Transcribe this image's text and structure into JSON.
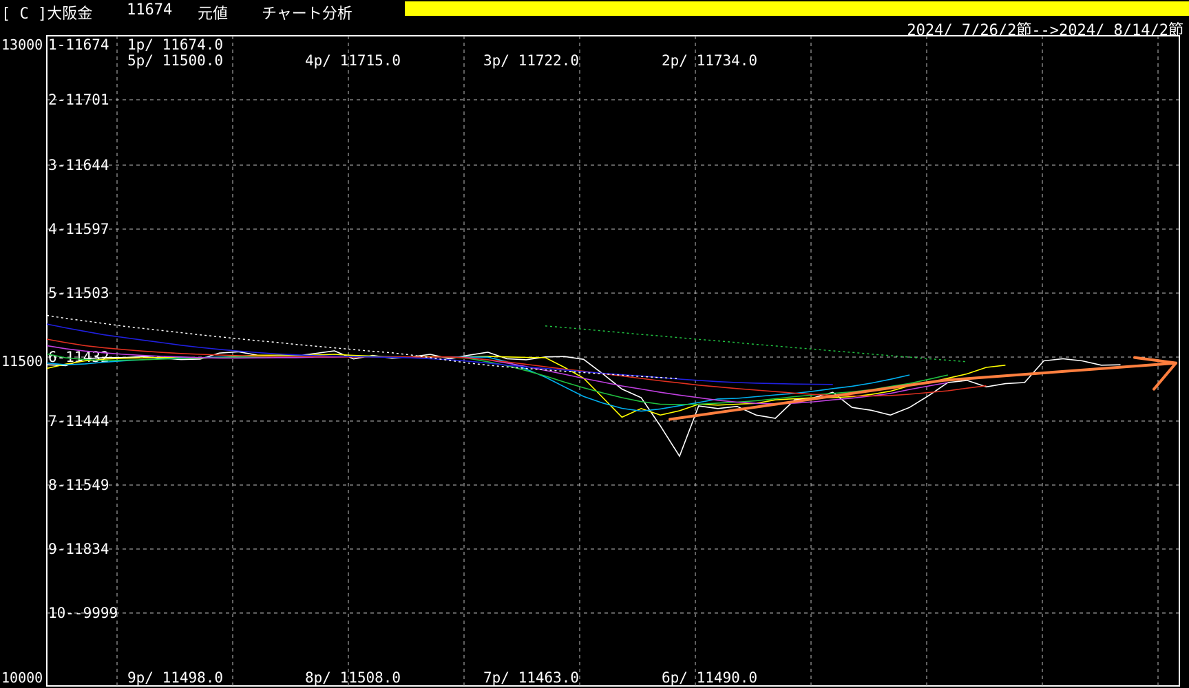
{
  "header": {
    "symbol": "[ C ]大阪金",
    "price": "11674",
    "mode": "元値",
    "tool": "チャート分析",
    "range": "2024/ 7/26/2節-->2024/ 8/14/2節",
    "highlight_color": "#ffff00"
  },
  "axis": {
    "top_label": "13000",
    "mid_label": "11500",
    "bottom_label": "10000"
  },
  "levels": [
    "1-11674",
    "2-11701",
    "3-11644",
    "4-11597",
    "5-11503",
    "6-11432",
    "7-11444",
    "8-11549",
    "9-11834",
    "10--9999"
  ],
  "pivots": [
    {
      "text": "1p/ 11674.0"
    },
    {
      "text": "5p/ 11500.0"
    },
    {
      "text": "4p/ 11715.0"
    },
    {
      "text": "3p/ 11722.0"
    },
    {
      "text": "2p/ 11734.0"
    },
    {
      "text": "9p/ 11498.0"
    },
    {
      "text": "8p/ 11508.0"
    },
    {
      "text": "7p/ 11463.0"
    },
    {
      "text": "6p/ 11490.0"
    }
  ],
  "chart_data": {
    "type": "line",
    "ylim": [
      10000,
      13000
    ],
    "grid": true,
    "n_periods": 60,
    "series": [
      {
        "color": "#ffffff",
        "dashed": false,
        "values": [
          11482,
          11478,
          11510,
          11515,
          11515,
          11520,
          11512,
          11506,
          11508,
          11536,
          11542,
          11526,
          11520,
          11523,
          11534,
          11546,
          11509,
          11525,
          11512,
          11518,
          11530,
          11510,
          11526,
          11540,
          11510,
          11505,
          11518,
          11520,
          11507,
          11440,
          11370,
          11330,
          11200,
          11060,
          11292,
          11280,
          11290,
          11250,
          11235,
          11320,
          11330,
          11355,
          11285,
          11272,
          11250,
          11285,
          11340,
          11400,
          11410,
          11380,
          11395,
          11400,
          11500,
          11510,
          11500,
          11480,
          11482
        ]
      },
      {
        "color": "#ffff00",
        "dashed": false,
        "values": [
          11465,
          11485,
          11500,
          11508,
          11512,
          11514,
          11516,
          11514,
          11512,
          11516,
          11522,
          11526,
          11526,
          11525,
          11527,
          11530,
          11525,
          11522,
          11518,
          11518,
          11520,
          11517,
          11518,
          11521,
          11518,
          11516,
          11515,
          11470,
          11420,
          11330,
          11240,
          11280,
          11250,
          11270,
          11300,
          11296,
          11300,
          11304,
          11320,
          11325,
          11330,
          11330,
          11335,
          11345,
          11360,
          11385,
          11400,
          11420,
          11440,
          11470,
          11480
        ]
      },
      {
        "color": "#00b0f0",
        "dashed": false,
        "values": [
          11490,
          11482,
          11486,
          11494,
          11500,
          11505,
          11510,
          11513,
          11515,
          11517,
          11518,
          11520,
          11522,
          11522,
          11522,
          11521,
          11520,
          11519,
          11519,
          11518,
          11518,
          11518,
          11517,
          11517,
          11496,
          11462,
          11425,
          11380,
          11336,
          11305,
          11281,
          11268,
          11278,
          11293,
          11308,
          11324,
          11327,
          11335,
          11343,
          11350,
          11360,
          11372,
          11383,
          11397,
          11415,
          11435
        ]
      },
      {
        "color": "#20c040",
        "dashed": false,
        "values": [
          11532,
          11514,
          11506,
          11502,
          11503,
          11505,
          11508,
          11511,
          11513,
          11515,
          11517,
          11518,
          11519,
          11520,
          11521,
          11520,
          11520,
          11519,
          11518,
          11518,
          11518,
          11518,
          11511,
          11496,
          11478,
          11455,
          11430,
          11402,
          11376,
          11352,
          11330,
          11312,
          11300,
          11298,
          11300,
          11305,
          11310,
          11316,
          11325,
          11335,
          11343,
          11350,
          11357,
          11367,
          11382,
          11396,
          11415,
          11435
        ]
      },
      {
        "color": "#c040e0",
        "dashed": false,
        "values": [
          11570,
          11556,
          11545,
          11537,
          11530,
          11525,
          11521,
          11518,
          11515,
          11513,
          11513,
          11514,
          11515,
          11515,
          11517,
          11517,
          11518,
          11518,
          11518,
          11518,
          11518,
          11518,
          11515,
          11505,
          11490,
          11474,
          11456,
          11438,
          11419,
          11402,
          11384,
          11370,
          11355,
          11342,
          11330,
          11318,
          11310,
          11304,
          11302,
          11305,
          11311,
          11320,
          11328,
          11338,
          11350,
          11368,
          11384,
          11400
        ]
      },
      {
        "color": "#e03020",
        "dashed": false,
        "values": [
          11600,
          11584,
          11570,
          11560,
          11552,
          11545,
          11539,
          11534,
          11530,
          11527,
          11524,
          11522,
          11521,
          11520,
          11519,
          11519,
          11518,
          11518,
          11518,
          11518,
          11518,
          11518,
          11513,
          11505,
          11495,
          11484,
          11473,
          11462,
          11452,
          11441,
          11430,
          11419,
          11408,
          11398,
          11388,
          11380,
          11372,
          11365,
          11358,
          11351,
          11345,
          11341,
          11338,
          11338,
          11340,
          11346,
          11354,
          11362,
          11374,
          11385
        ]
      },
      {
        "color": "#2020e0",
        "dashed": false,
        "values": [
          11670,
          11652,
          11636,
          11620,
          11608,
          11596,
          11584,
          11572,
          11562,
          11553,
          11545,
          11538,
          11532,
          11528,
          11524,
          11522,
          11520,
          11518,
          11516,
          11514,
          11510,
          11505,
          11498,
          11490,
          11480,
          11472,
          11465,
          11458,
          11450,
          11443,
          11436,
          11430,
          11423,
          11416,
          11410,
          11404,
          11400,
          11397,
          11395,
          11393,
          11392,
          11391
        ]
      },
      {
        "color": "#ffffff",
        "dashed": true,
        "values": [
          11710,
          11696,
          11684,
          11672,
          11660,
          11650,
          11640,
          11630,
          11620,
          11611,
          11602,
          11593,
          11585,
          11576,
          11568,
          11560,
          11552,
          11544,
          11537,
          11527,
          11515,
          11502,
          11490,
          11480,
          11472,
          11465,
          11458,
          11452,
          11446,
          11440,
          11434,
          11428,
          11423,
          11418
        ]
      },
      {
        "color": "#20c040",
        "dashed": true,
        "values": [
          11661,
          11654,
          11646,
          11638,
          11630,
          11622,
          11615,
          11607,
          11599,
          11592,
          11584,
          11576,
          11569,
          11561,
          11554,
          11546,
          11539,
          11531,
          11524,
          11517,
          11510,
          11503,
          11496
        ]
      },
      {
        "color": "#ff7f3f",
        "dashed": false,
        "values": [
          11230,
          11410,
          11490
        ]
      }
    ]
  },
  "colors": {
    "background": "#000000",
    "grid": "#bfbfbf",
    "trend": "#ff7f3f"
  }
}
